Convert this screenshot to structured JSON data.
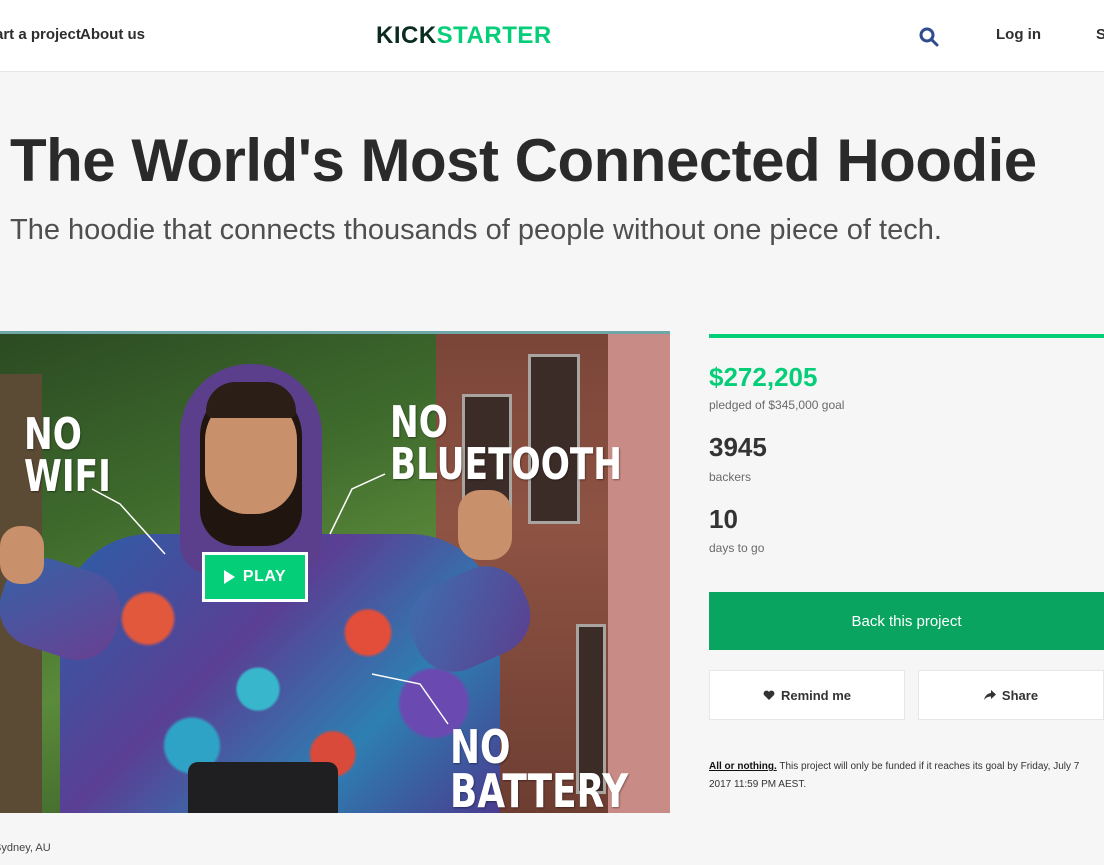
{
  "nav": {
    "start_label": "Start a project",
    "about_label": "About us",
    "logo_part1": "KICK",
    "logo_part2": "STARTER",
    "login_label": "Log in",
    "signup_label": "Sign up"
  },
  "project": {
    "title": "The World's Most Connected Hoodie",
    "subtitle": "The hoodie that connects thousands of people without one piece of tech.",
    "location": "Sydney, AU"
  },
  "video": {
    "play_label": "PLAY",
    "callout_wifi": [
      "NO",
      "WIFI"
    ],
    "callout_bluetooth": [
      "NO",
      "BLUETOOTH"
    ],
    "callout_battery": [
      "NO",
      "BATTERY"
    ]
  },
  "stats": {
    "pledged": "$272,205",
    "pledged_sub": "pledged of $345,000 goal",
    "backers": "3945",
    "backers_sub": "backers",
    "days": "10",
    "days_sub": "days to go"
  },
  "actions": {
    "back_label": "Back this project",
    "remind_label": "Remind me",
    "share_label": "Share"
  },
  "aon": {
    "link": "All or nothing.",
    "text": " This project will only be funded if it reaches its goal by Friday, July 7 2017 11:59 PM AEST."
  },
  "colors": {
    "brand_green": "#05ce78",
    "button_green": "#09a560",
    "logo_dark": "#0b2b1e"
  }
}
